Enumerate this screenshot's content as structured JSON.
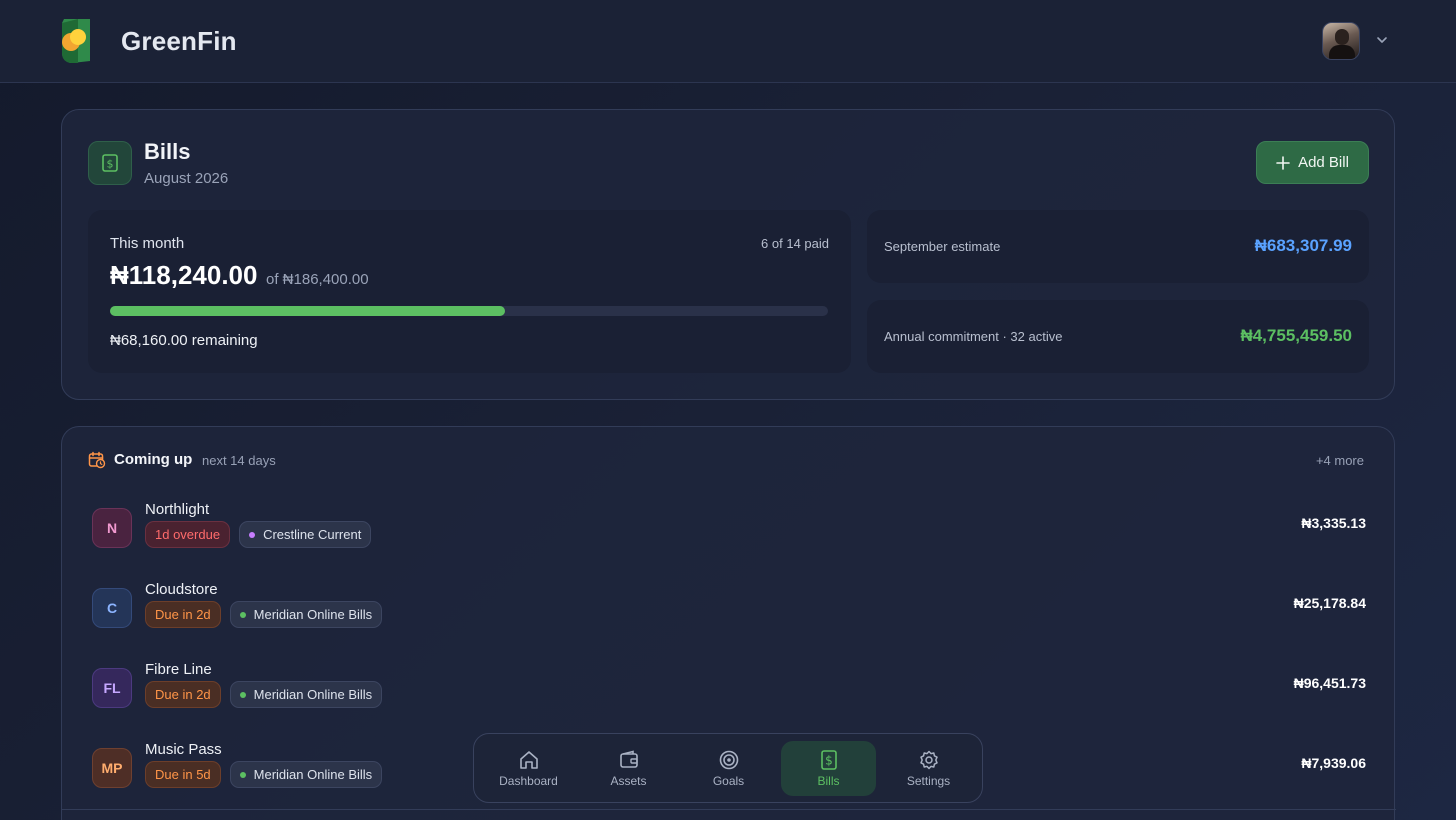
{
  "header": {
    "brand": "GreenFin",
    "avatar_icon": "user-avatar",
    "menu_icon": "chevron-down-icon"
  },
  "bills": {
    "title": "Bills",
    "subtitle": "August 2026",
    "add_button": "Add Bill",
    "this_month": {
      "label": "This month",
      "paid_status": "6 of 14 paid",
      "amount": "₦118,240.00",
      "of_total": "of ₦186,400.00",
      "progress_fraction": 0.55,
      "remaining": "₦68,160.00 remaining"
    },
    "september": {
      "label": "September estimate",
      "value": "₦683,307.99"
    },
    "annual": {
      "label": "Annual commitment · 32 active",
      "value": "₦4,755,459.50"
    }
  },
  "upcoming": {
    "title": "Coming up",
    "subtitle": "next 14 days",
    "more": "+4 more",
    "items": [
      {
        "initials": "N",
        "name": "Northlight",
        "status": "1d overdue",
        "status_type": "overdue",
        "account": "Crestline Current",
        "account_color": "#c77dff",
        "amount": "₦3,335.13",
        "avatar_bg": "#4a2340",
        "avatar_border": "#6a3358",
        "avatar_fg": "#f29ad0"
      },
      {
        "initials": "C",
        "name": "Cloudstore",
        "status": "Due in 2d",
        "status_type": "due",
        "account": "Meridian Online Bills",
        "account_color": "#5cbf62",
        "amount": "₦25,178.84",
        "avatar_bg": "#243558",
        "avatar_border": "#344a7a",
        "avatar_fg": "#8cb4ff"
      },
      {
        "initials": "FL",
        "name": "Fibre Line",
        "status": "Due in 2d",
        "status_type": "due",
        "account": "Meridian Online Bills",
        "account_color": "#5cbf62",
        "amount": "₦96,451.73",
        "avatar_bg": "#35285c",
        "avatar_border": "#4c3a80",
        "avatar_fg": "#c6a8ff"
      },
      {
        "initials": "MP",
        "name": "Music Pass",
        "status": "Due in 5d",
        "status_type": "due",
        "account": "Meridian Online Bills",
        "account_color": "#5cbf62",
        "amount": "₦7,939.06",
        "avatar_bg": "#4e2e26",
        "avatar_border": "#6e4030",
        "avatar_fg": "#ffad6e"
      }
    ]
  },
  "nav": {
    "items": [
      {
        "label": "Dashboard",
        "icon": "home-icon"
      },
      {
        "label": "Assets",
        "icon": "wallet-icon"
      },
      {
        "label": "Goals",
        "icon": "target-icon"
      },
      {
        "label": "Bills",
        "icon": "bill-icon",
        "active": true
      },
      {
        "label": "Settings",
        "icon": "gear-icon"
      }
    ]
  },
  "colors": {
    "accent_green": "#5cbf62",
    "accent_blue": "#5aa2ff",
    "overdue_red": "#ff6b6b",
    "due_orange": "#ff9548"
  }
}
